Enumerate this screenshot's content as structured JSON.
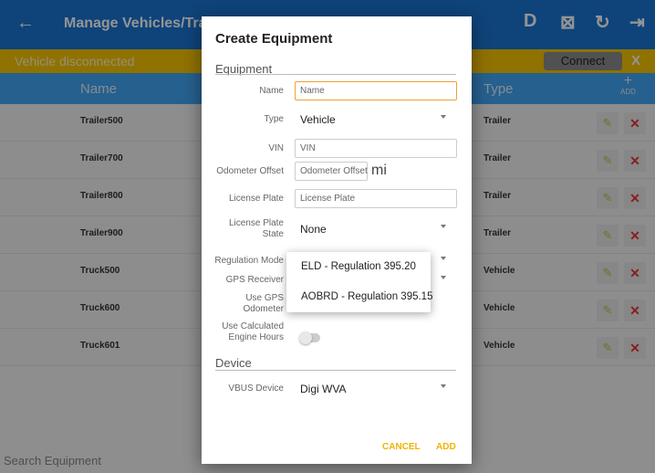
{
  "app": {
    "title": "Manage Vehicles/Trailers",
    "back_icon": "←",
    "top_icons": [
      "D",
      "⊠",
      "↻",
      "⇥"
    ],
    "status_text": "Vehicle disconnected",
    "connect_label": "Connect",
    "close_label": "X",
    "table": {
      "columns": [
        "Name",
        "Type"
      ],
      "add_symbol": "+",
      "add_label": "ADD",
      "rows": [
        {
          "name": "Trailer500",
          "type": "Trailer"
        },
        {
          "name": "Trailer700",
          "type": "Trailer"
        },
        {
          "name": "Trailer800",
          "type": "Trailer"
        },
        {
          "name": "Trailer900",
          "type": "Trailer"
        },
        {
          "name": "Truck500",
          "type": "Vehicle"
        },
        {
          "name": "Truck600",
          "type": "Vehicle"
        },
        {
          "name": "Truck601",
          "type": "Vehicle"
        }
      ]
    },
    "search_placeholder": "Search Equipment"
  },
  "dialog": {
    "title": "Create Equipment",
    "equipment_section": "Equipment",
    "fields": {
      "name_label": "Name",
      "name_placeholder": "Name",
      "type_label": "Type",
      "type_value": "Vehicle",
      "vin_label": "VIN",
      "vin_placeholder": "VIN",
      "odometer_label": "Odometer Offset",
      "odometer_placeholder": "Odometer Offset",
      "odometer_unit": "mi",
      "plate_label": "License Plate",
      "plate_placeholder": "License Plate",
      "plate_state_label_1": "License Plate",
      "plate_state_label_2": "State",
      "plate_state_value": "None",
      "regulation_label": "Regulation Mode",
      "gps_label": "GPS Receiver",
      "use_gps_label_1": "Use GPS",
      "use_gps_label_2": "Odometer",
      "calc_hours_label_1": "Use Calculated",
      "calc_hours_label_2": "Engine Hours"
    },
    "device_section": "Device",
    "vbus_label": "VBUS Device",
    "vbus_value": "Digi WVA",
    "cancel_label": "CANCEL",
    "add_label": "ADD"
  },
  "regulation_dropdown": {
    "options": [
      "ELD - Regulation 395.20",
      "AOBRD - Regulation 395.15"
    ]
  },
  "colors": {
    "header_blue": "#1976d2",
    "table_header_blue": "#42a5f5",
    "status_yellow": "#f6c500",
    "action_yellow": "#f2b200",
    "delete_red": "#e53935"
  }
}
